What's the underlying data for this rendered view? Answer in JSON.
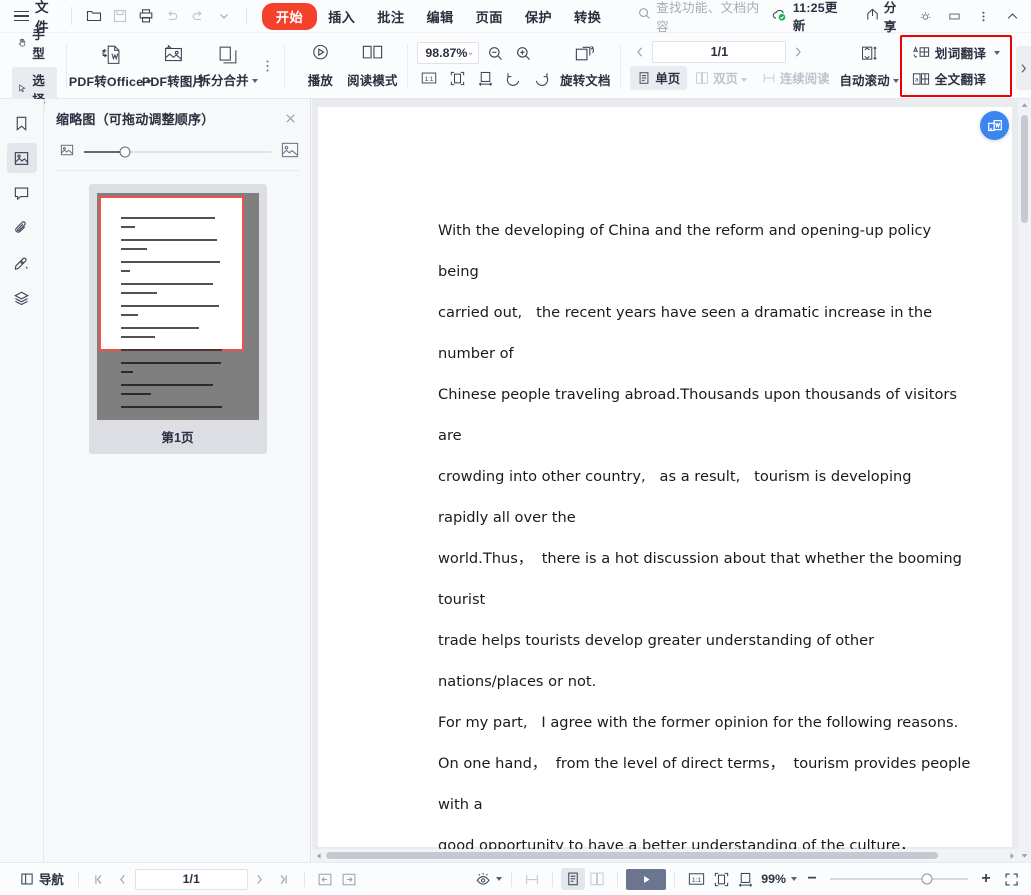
{
  "titlebar": {
    "menu_icon": "hamburger-icon",
    "file_label": "文件",
    "quick_icons": [
      "open-folder-icon",
      "save-icon",
      "print-icon",
      "undo-icon",
      "redo-icon",
      "quick-access-dropdown-icon"
    ],
    "tabs": [
      {
        "label": "开始",
        "active": true
      },
      {
        "label": "插入",
        "active": false
      },
      {
        "label": "批注",
        "active": false
      },
      {
        "label": "编辑",
        "active": false
      },
      {
        "label": "页面",
        "active": false
      },
      {
        "label": "保护",
        "active": false
      },
      {
        "label": "转换",
        "active": false
      }
    ],
    "search_placeholder": "查找功能、文档内容",
    "update_label": "11:25更新",
    "share_label": "分享",
    "window_icons": [
      "settings-gear-icon",
      "minimize-icon",
      "more-options-icon",
      "collapse-ribbon-icon"
    ],
    "active_tab_color": "#f5402c"
  },
  "ribbon": {
    "hand_label": "手型",
    "select_label": "选择",
    "select_active": true,
    "pdf_to_office_label": "PDF转Office",
    "pdf_to_image_label": "PDF转图片",
    "split_merge_label": "拆分合并",
    "play_label": "播放",
    "read_mode_label": "阅读模式",
    "zoom_value": "98.87%",
    "zoom_out_icon": "zoom-out-icon",
    "zoom_in_icon": "zoom-in-icon",
    "fit_actual_icon": "actual-size-icon",
    "fit_page_icon": "fit-page-icon",
    "fit_width_icon": "fit-width-icon",
    "rotate_ccw_icon": "rotate-counterclockwise-icon",
    "rotate_cw_icon": "rotate-clockwise-icon",
    "rotate_doc_label": "旋转文档",
    "page_field": "1/1",
    "single_page_label": "单页",
    "double_page_label": "双页",
    "continuous_read_label": "连续阅读",
    "auto_scroll_label": "自动滚动",
    "word_translate_label": "划词翻译",
    "full_translate_label": "全文翻译",
    "highlight_color": "#ee0000"
  },
  "rail": {
    "items": [
      {
        "icon": "bookmark-icon",
        "selected": false
      },
      {
        "icon": "thumbnail-icon",
        "selected": true
      },
      {
        "icon": "comment-icon",
        "selected": false
      },
      {
        "icon": "attachment-icon",
        "selected": false
      },
      {
        "icon": "signature-icon",
        "selected": false
      },
      {
        "icon": "layers-icon",
        "selected": false
      }
    ]
  },
  "thumbnail_panel": {
    "title": "缩略图（可拖动调整顺序）",
    "close_icon": "close-icon",
    "small_thumb_icon": "small-image-icon",
    "large_thumb_icon": "large-image-icon",
    "slider_value": 22,
    "page_caption": "第1页"
  },
  "document": {
    "lines": [
      "With the developing of China and the reform and opening-up policy",
      "being",
      "carried out,   the recent years have seen a dramatic increase in the",
      "number of",
      "Chinese people traveling abroad.Thousands upon thousands of visitors",
      "are",
      "crowding into other country,   as a result,   tourism is developing",
      "rapidly all over the",
      "world.Thus，  there is a hot discussion about that whether the booming",
      "tourist",
      "trade helps tourists develop greater understanding of other",
      "nations/places or not.",
      "For my part,   I agree with the former opinion for the following reasons.",
      "On one hand，  from the level of direct terms，  tourism provides people",
      "with a",
      "good opportunity to have a better understanding of the culture，"
    ],
    "fab_icon": "convert-to-word-icon",
    "fab_color": "#3a85f0"
  },
  "statusbar": {
    "nav_label": "导航",
    "first_page_icon": "first-page-icon",
    "prev_page_icon": "prev-page-icon",
    "page_field": "1/1",
    "next_page_icon": "next-page-icon",
    "last_page_icon": "last-page-icon",
    "back_icon": "go-back-icon",
    "forward_icon": "go-forward-icon",
    "eye_icon": "view-mode-icon",
    "facing_icon": "facing-pages-icon",
    "single_page_icon": "single-page-view-icon",
    "double_page_icon": "double-page-view-icon",
    "slideshow_icon": "slideshow-icon",
    "actual_size_icon": "actual-size-icon",
    "fit_page_icon": "fit-page-icon",
    "fit_width_icon": "fit-width-icon",
    "zoom_value": "99%",
    "zoom_minus": "−",
    "zoom_plus": "+",
    "fullscreen_icon": "fullscreen-icon",
    "zoom_slider_pct": 70
  }
}
